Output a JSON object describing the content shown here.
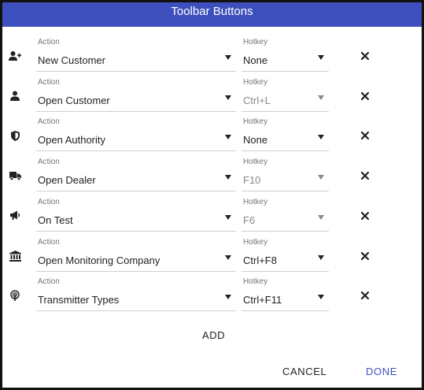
{
  "dialog": {
    "title": "Toolbar Buttons",
    "accent_color": "#3d4fbd"
  },
  "labels": {
    "action": "Action",
    "hotkey": "Hotkey"
  },
  "rows": [
    {
      "icon": "add-user-icon",
      "action": "New Customer",
      "hotkey": "None",
      "hotkey_disabled": false
    },
    {
      "icon": "user-icon",
      "action": "Open Customer",
      "hotkey": "Ctrl+L",
      "hotkey_disabled": true
    },
    {
      "icon": "shield-icon",
      "action": "Open Authority",
      "hotkey": "None",
      "hotkey_disabled": false
    },
    {
      "icon": "truck-icon",
      "action": "Open Dealer",
      "hotkey": "F10",
      "hotkey_disabled": true
    },
    {
      "icon": "megaphone-icon",
      "action": "On Test",
      "hotkey": "F6",
      "hotkey_disabled": true
    },
    {
      "icon": "bank-icon",
      "action": "Open Monitoring Company",
      "hotkey": "Ctrl+F8",
      "hotkey_disabled": false
    },
    {
      "icon": "podcast-icon",
      "action": "Transmitter Types",
      "hotkey": "Ctrl+F11",
      "hotkey_disabled": false
    }
  ],
  "buttons": {
    "add": "ADD",
    "cancel": "CANCEL",
    "done": "DONE"
  }
}
